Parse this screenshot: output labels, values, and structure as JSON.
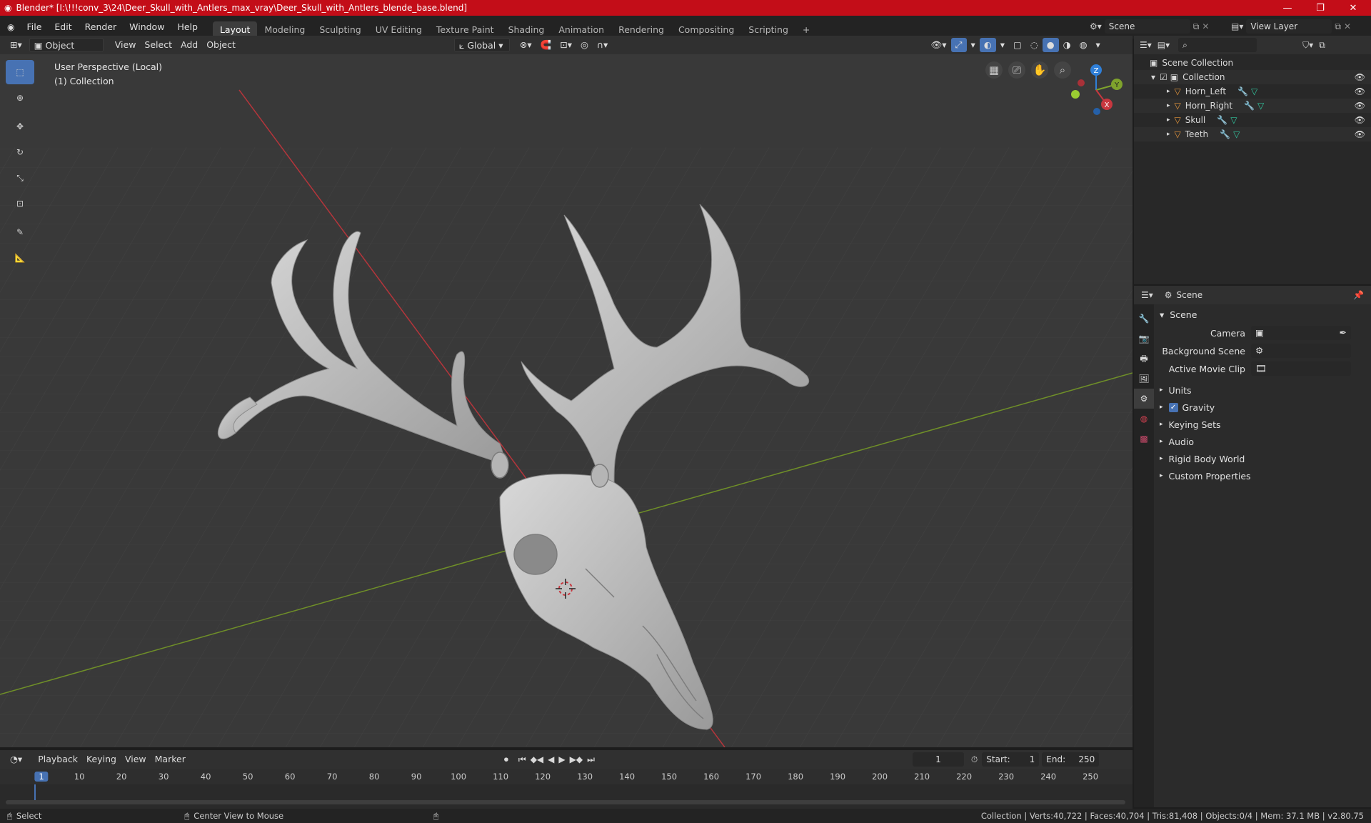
{
  "title_bar": {
    "text": "Blender* [I:\\!!!conv_3\\24\\Deer_Skull_with_Antlers_max_vray\\Deer_Skull_with_Antlers_blende_base.blend]",
    "minimize": "—",
    "maximize": "❐",
    "close": "✕"
  },
  "menu": [
    "File",
    "Edit",
    "Render",
    "Window",
    "Help"
  ],
  "workspaces": [
    "Layout",
    "Modeling",
    "Sculpting",
    "UV Editing",
    "Texture Paint",
    "Shading",
    "Animation",
    "Rendering",
    "Compositing",
    "Scripting"
  ],
  "active_workspace": "Layout",
  "scene_field": "Scene",
  "view_layer_field": "View Layer",
  "viewport_header": {
    "mode": "Object Mode",
    "menus": [
      "View",
      "Select",
      "Add",
      "Object"
    ],
    "orientation": "Global"
  },
  "viewport_overlay": {
    "perspective": "User Perspective (Local)",
    "collection": "(1) Collection"
  },
  "gizmo": {
    "z": "Z",
    "y": "Y",
    "x": "X"
  },
  "outliner": {
    "root": "Scene Collection",
    "collection": "Collection",
    "objects": [
      "Horn_Left",
      "Horn_Right",
      "Skull",
      "Teeth"
    ]
  },
  "properties": {
    "header": "Scene",
    "panel": "Scene",
    "camera_label": "Camera",
    "background_label": "Background Scene",
    "movie_clip_label": "Active Movie Clip",
    "sections": [
      "Units",
      "Gravity",
      "Keying Sets",
      "Audio",
      "Rigid Body World",
      "Custom Properties"
    ]
  },
  "timeline": {
    "menus": [
      "Playback",
      "Keying",
      "View",
      "Marker"
    ],
    "current_frame": "1",
    "start_label": "Start:",
    "start": "1",
    "end_label": "End:",
    "end": "250",
    "ticks": [
      "1",
      "10",
      "20",
      "30",
      "40",
      "50",
      "60",
      "70",
      "80",
      "90",
      "100",
      "110",
      "120",
      "130",
      "140",
      "150",
      "160",
      "170",
      "180",
      "190",
      "200",
      "210",
      "220",
      "230",
      "240",
      "250"
    ]
  },
  "status_bar": {
    "select": "Select",
    "center": "Center View to Mouse",
    "stats": "Collection | Verts:40,722 | Faces:40,704 | Tris:81,408 | Objects:0/4 | Mem: 37.1 MB | v2.80.75"
  },
  "colors": {
    "accent": "#4772b3",
    "title_bar": "#c30d18",
    "object_orange": "#e5963c",
    "x_axis": "#c8373f",
    "y_axis": "#7fa32c"
  }
}
